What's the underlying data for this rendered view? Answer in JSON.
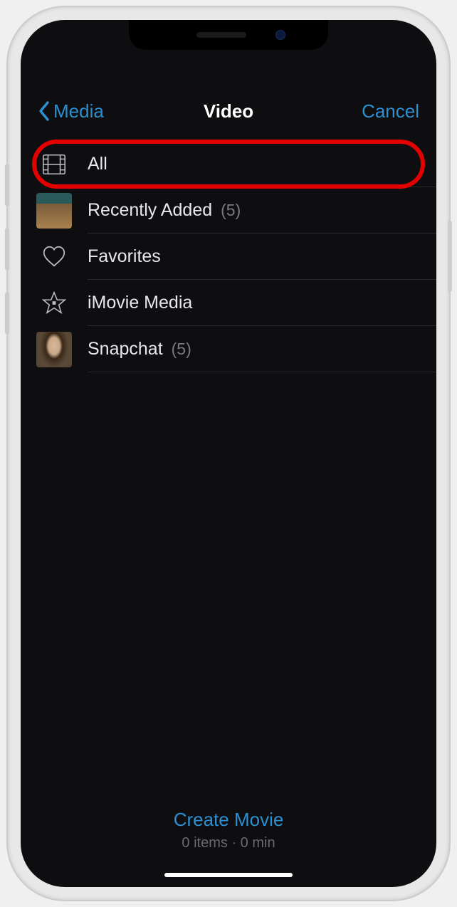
{
  "nav": {
    "back_label": "Media",
    "title": "Video",
    "cancel_label": "Cancel"
  },
  "albums": [
    {
      "icon": "film-icon",
      "label": "All",
      "count": null,
      "highlighted": true
    },
    {
      "icon": "thumb-room",
      "label": "Recently Added",
      "count": "(5)",
      "highlighted": false
    },
    {
      "icon": "heart-icon",
      "label": "Favorites",
      "count": null,
      "highlighted": false
    },
    {
      "icon": "star-icon",
      "label": "iMovie Media",
      "count": null,
      "highlighted": false
    },
    {
      "icon": "thumb-face",
      "label": "Snapchat",
      "count": "(5)",
      "highlighted": false
    }
  ],
  "footer": {
    "action_label": "Create Movie",
    "status": "0 items · 0 min"
  },
  "colors": {
    "accent": "#2d8fcf",
    "highlight_ring": "#e30000",
    "background": "#0e0e10"
  }
}
